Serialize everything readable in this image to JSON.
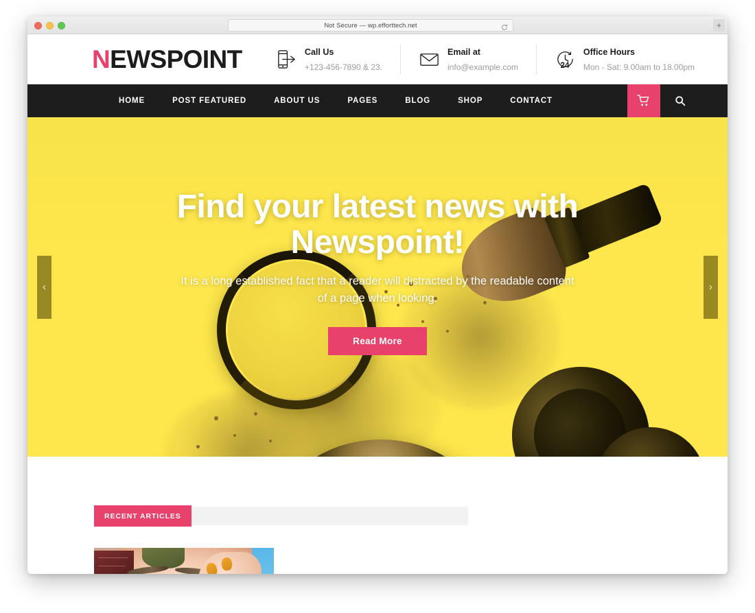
{
  "browser": {
    "url_text": "Not Secure — wp.efforttech.net",
    "reload_label": "",
    "new_tab_label": "+",
    "traffic_close": "",
    "traffic_minimize": "",
    "traffic_zoom": ""
  },
  "header": {
    "logo_first": "N",
    "logo_rest": "EWSPOINT",
    "info": [
      {
        "icon": "mobile-phone-icon",
        "title": "Call Us",
        "sub": "+123-456-7890 & 23."
      },
      {
        "icon": "envelope-icon",
        "title": "Email at",
        "sub": "info@example.com"
      },
      {
        "icon": "clock-24-icon",
        "title": "Office Hours",
        "sub": "Mon - Sat: 9.00am to 18.00pm"
      }
    ]
  },
  "nav": {
    "items": [
      {
        "label": "HOME"
      },
      {
        "label": "POST FEATURED"
      },
      {
        "label": "ABOUT US"
      },
      {
        "label": "PAGES"
      },
      {
        "label": "BLOG"
      },
      {
        "label": "SHOP"
      },
      {
        "label": "CONTACT"
      }
    ],
    "cart_icon": "shopping-cart-icon",
    "search_icon": "search-icon",
    "cart_accent": "#e8416b",
    "bar_color": "#1d1d1d"
  },
  "hero": {
    "title": "Find your latest news with Newspoint!",
    "subtitle": "It is a long established fact that a reader will distracted by the readable content of a page when looking.",
    "cta_label": "Read More",
    "prev_label": "‹",
    "next_label": "›",
    "background_color": "#fde74c",
    "cta_color": "#e8416b"
  },
  "content": {
    "section_tab_label": "RECENT ARTICLES",
    "section_tab_color": "#e8416b",
    "section_bar_color": "#f2f2f2"
  }
}
